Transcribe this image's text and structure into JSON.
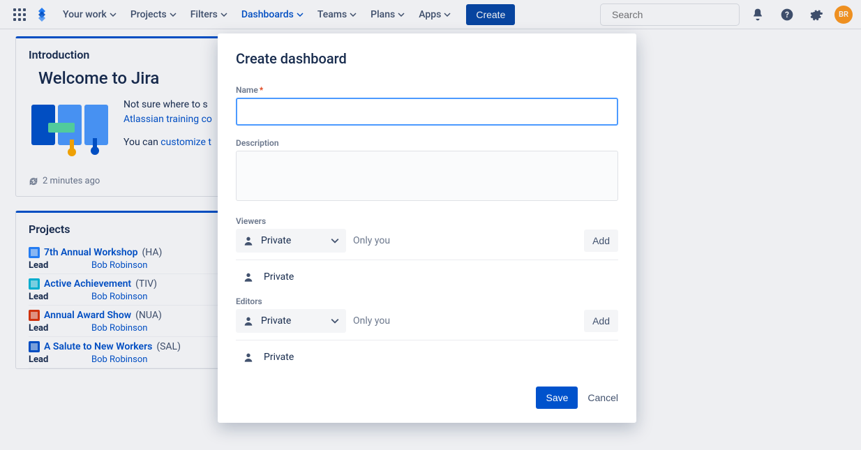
{
  "nav": {
    "your_work": "Your work",
    "projects": "Projects",
    "filters": "Filters",
    "dashboards": "Dashboards",
    "teams": "Teams",
    "plans": "Plans",
    "apps": "Apps",
    "create": "Create",
    "search_placeholder": "Search",
    "avatar_initials": "BR"
  },
  "intro": {
    "heading": "Introduction",
    "welcome": "Welcome to Jira",
    "line1_a": "Not sure where to s",
    "line1_link": "Atlassian training co",
    "line2_a": "You can ",
    "line2_link": "customize t",
    "timestamp": "2 minutes ago"
  },
  "projects": {
    "heading": "Projects",
    "lead_label": "Lead",
    "items": [
      {
        "name": "7th Annual Workshop",
        "key": "(HA)",
        "lead": "Bob Robinson",
        "color": "#2684FF"
      },
      {
        "name": "Active Achievement",
        "key": "(TIV)",
        "lead": "Bob Robinson",
        "color": "#00B8D9"
      },
      {
        "name": "Annual Award Show",
        "key": "(NUA)",
        "lead": "Bob Robinson",
        "color": "#DE350B"
      },
      {
        "name": "A Salute to New Workers",
        "key": "(SAL)",
        "lead": "Bob Robinson",
        "color": "#0052CC"
      }
    ]
  },
  "modal": {
    "title": "Create dashboard",
    "name_label": "Name",
    "desc_label": "Description",
    "viewers_label": "Viewers",
    "editors_label": "Editors",
    "private": "Private",
    "only_you": "Only you",
    "add": "Add",
    "save": "Save",
    "cancel": "Cancel"
  }
}
